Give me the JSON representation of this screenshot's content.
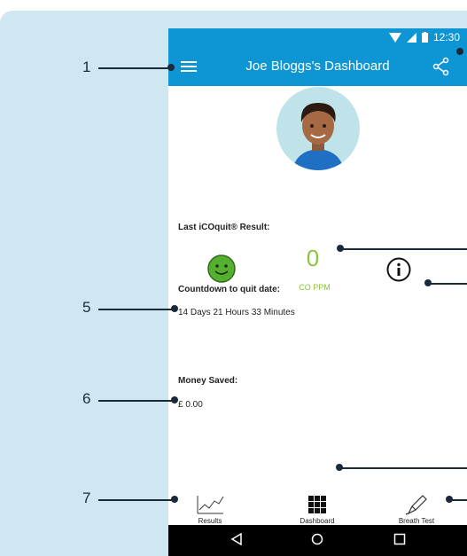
{
  "status": {
    "time": "12:30"
  },
  "header": {
    "title": "Joe Bloggs's Dashboard"
  },
  "result": {
    "label": "Last iCOquit® Result:",
    "value": "0",
    "unit": "CO PPM"
  },
  "countdown": {
    "label": "Countdown to quit date:",
    "value": "14 Days 21 Hours 33 Minutes"
  },
  "money": {
    "label": "Money Saved:",
    "value": "£ 0.00"
  },
  "nav": {
    "results": "Results",
    "dashboard": "Dashboard",
    "breath_test": "Breath Test"
  },
  "callouts": [
    "1",
    "5",
    "6",
    "7"
  ],
  "colors": {
    "primary": "#0e95d4",
    "accent": "#8dc33f",
    "panel": "#cfe7f1"
  },
  "icons": [
    "menu-icon",
    "share-icon",
    "smiley-icon",
    "info-icon",
    "chart-icon",
    "grid-icon",
    "pen-icon",
    "back-icon",
    "home-icon",
    "recents-icon"
  ]
}
